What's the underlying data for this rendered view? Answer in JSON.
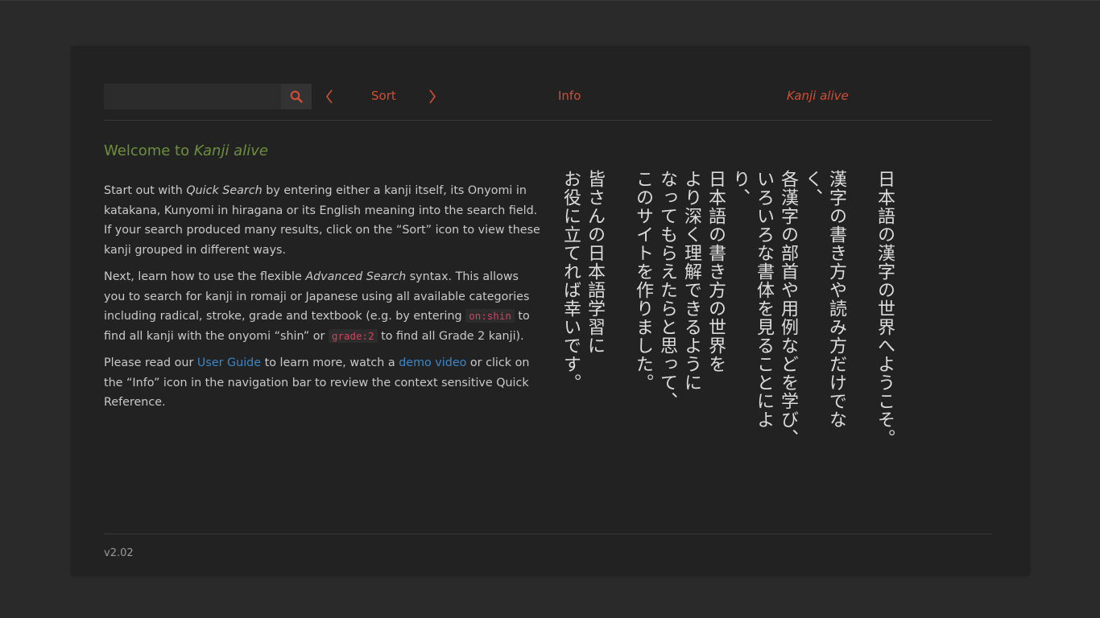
{
  "search": {
    "placeholder": "",
    "value": ""
  },
  "nav": {
    "sort_label": "Sort",
    "info_label": "Info",
    "brand_label": "Kanji alive",
    "accent_color": "#d24f36"
  },
  "welcome": {
    "prefix": "Welcome to ",
    "brand": "Kanji alive"
  },
  "paragraphs": {
    "p1": {
      "a": "Start out with ",
      "b": "Quick Search",
      "c": " by entering either a kanji itself, its Onyomi in katakana, Kunyomi in hiragana or its English meaning into the search field. If your search produced many results, click on the “Sort” icon to view these kanji grouped in different ways."
    },
    "p2": {
      "a": "Next, learn how to use the flexible ",
      "b": "Advanced Search",
      "c": " syntax. This allows you to search for kanji in romaji or Japanese using all available categories including radical, stroke, grade and textbook (e.g. by entering ",
      "code1": "on:shin",
      "d": " to find all kanji with the onyomi “shin” or ",
      "code2": "grade:2",
      "e": " to find all Grade 2 kanji)."
    },
    "p3": {
      "a": "Please read our ",
      "guide_link": "User Guide",
      "b": " to learn more, watch a ",
      "video_link": "demo video",
      "c": " or click on the “Info” icon in the navigation bar to review the context sensitive Quick Reference."
    }
  },
  "japanese": {
    "line1": "日本語の漢字の世界へようこそ。",
    "line2": "漢字の書き方や読み方だけでなく、",
    "line3": "各漢字の部首や用例などを学び、",
    "line4": "いろいろな書体を見ることにより、",
    "line5": "日本語の書き方の世界を",
    "line6": "より深く理解できるように",
    "line7": "なってもらえたらと思って、",
    "line8": "このサイトを作りました。",
    "line9": "皆さんの日本語学習に",
    "line10": "お役に立てれば幸いです。"
  },
  "footer": {
    "version": "v2.02"
  },
  "colors": {
    "background": "#2a2a2a",
    "panel": "#222222",
    "welcome_green": "#6d8f3d",
    "link_blue": "#3b87c8",
    "code_red": "#d0435f"
  },
  "icons": {
    "search": "search-icon",
    "prev": "chevron-left-icon",
    "next": "chevron-right-icon"
  }
}
